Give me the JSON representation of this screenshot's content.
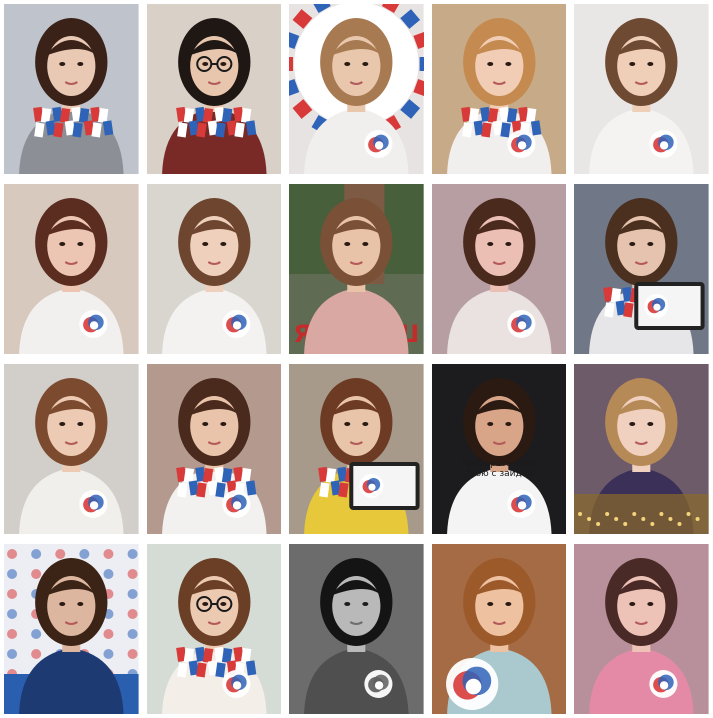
{
  "grid": {
    "columns": 5,
    "rows": 4
  },
  "tiles": [
    {
      "subject": "girl-selfie-scarf",
      "bg": "#bfc3cb",
      "top": "#8d8f96",
      "hair": "#3a2219",
      "skin": "#e9c8b4",
      "scarf": true,
      "logo": false,
      "text": ""
    },
    {
      "subject": "girl-glasses-scarf",
      "bg": "#d9d1c7",
      "top": "#7a2a26",
      "hair": "#1f1714",
      "skin": "#e8c6ad",
      "scarf": true,
      "logo": false,
      "glasses": true,
      "text": ""
    },
    {
      "subject": "girl-logo-backdrop",
      "bg": "#e8e3e3",
      "top": "#f0efee",
      "hair": "#a87a52",
      "skin": "#e8c7ad",
      "scarf": false,
      "logo": true,
      "text": ""
    },
    {
      "subject": "girl-blonde-logo-scarf",
      "bg": "#c7aa87",
      "top": "#f1efee",
      "hair": "#c48a4f",
      "skin": "#f0cdb4",
      "scarf": true,
      "logo": true,
      "text": ""
    },
    {
      "subject": "girl-white-shirt-badge",
      "bg": "#e9e7e6",
      "top": "#f4f3f2",
      "hair": "#6f4a33",
      "skin": "#efcfb8",
      "scarf": false,
      "logo": true,
      "text": ""
    },
    {
      "subject": "girl-long-hair-logo",
      "bg": "#d8c9bf",
      "top": "#f2f0ef",
      "hair": "#5b2d20",
      "skin": "#ecc6b2",
      "scarf": false,
      "logo": true,
      "text": ""
    },
    {
      "subject": "girl-leaning-logo",
      "bg": "#d9d6cf",
      "top": "#f3f2f1",
      "hair": "#6e4630",
      "skin": "#efd0bd",
      "scarf": false,
      "logo": true,
      "text": ""
    },
    {
      "subject": "girl-sitting-outdoors",
      "bg": "#5f6b52",
      "top": "#d9a8a3",
      "hair": "#7a5036",
      "skin": "#e8c3a8",
      "scarf": false,
      "logo": false,
      "sign": "Я ♥ РДШ",
      "text": ""
    },
    {
      "subject": "girl-pink-lighting",
      "bg": "#b69ea2",
      "top": "#e9e2e0",
      "hair": "#4b2a1e",
      "skin": "#ecbfb4",
      "scarf": false,
      "logo": true,
      "text": ""
    },
    {
      "subject": "girl-holding-tablet",
      "bg": "#707888",
      "top": "#e6e6e9",
      "hair": "#4b3020",
      "skin": "#e6c3ae",
      "scarf": true,
      "logo": true,
      "tablet": true,
      "text": ""
    },
    {
      "subject": "girl-white-shirt-logo",
      "bg": "#d2cec9",
      "top": "#f1efec",
      "hair": "#7c4b2f",
      "skin": "#eccab3",
      "scarf": false,
      "logo": true,
      "text": ""
    },
    {
      "subject": "girl-scarf-logo",
      "bg": "#b49a8e",
      "top": "#f3f1f0",
      "hair": "#4a2a1c",
      "skin": "#e9c4ab",
      "scarf": true,
      "logo": true,
      "text": ""
    },
    {
      "subject": "girl-with-tablet",
      "bg": "#a79a8b",
      "top": "#e7c83a",
      "hair": "#6d3a24",
      "skin": "#e8c4a8",
      "scarf": true,
      "logo": true,
      "tablet": true,
      "text": ""
    },
    {
      "subject": "boy-text-shirt",
      "bg": "#1c1c1e",
      "top": "#f4f4f4",
      "hair": "#2a1a12",
      "skin": "#d8a588",
      "scarf": false,
      "logo": true,
      "text": "приборать тебе\nтвою с заидан"
    },
    {
      "subject": "girl-sparkle-frame",
      "bg": "#6d5b6a",
      "top": "#3b3158",
      "hair": "#b68a56",
      "skin": "#f0d0bf",
      "scarf": false,
      "logo": false,
      "sparkle": true,
      "text": ""
    },
    {
      "subject": "girl-event-booth",
      "bg": "#eceef3",
      "top": "#1e3a72",
      "hair": "#3b2316",
      "skin": "#dcb69e",
      "scarf": false,
      "logo": false,
      "booth": true,
      "text": ""
    },
    {
      "subject": "girl-glasses-logo-wall",
      "bg": "#d5dcd5",
      "top": "#f4eee9",
      "hair": "#6b3f26",
      "skin": "#ecc9b1",
      "scarf": true,
      "logo": true,
      "glasses": true,
      "text": ""
    },
    {
      "subject": "girl-black-white",
      "bg": "#6c6c6c",
      "top": "#4f4f4f",
      "hair": "#141414",
      "skin": "#b9b9b9",
      "scarf": false,
      "logo": true,
      "gray": true,
      "text": ""
    },
    {
      "subject": "girl-earphones-logo",
      "bg": "#a46b45",
      "top": "#a9c9cf",
      "hair": "#9c5a2a",
      "skin": "#eec1a1",
      "scarf": false,
      "logo": true,
      "bigLogo": true,
      "text": ""
    },
    {
      "subject": "girl-pink-shirt",
      "bg": "#b8909b",
      "top": "#e48aa7",
      "hair": "#4a2a26",
      "skin": "#eec3b7",
      "scarf": false,
      "logo": true,
      "text": ""
    }
  ],
  "colors": {
    "red": "#d83a3a",
    "blue": "#2f63b8",
    "white": "#ffffff"
  }
}
